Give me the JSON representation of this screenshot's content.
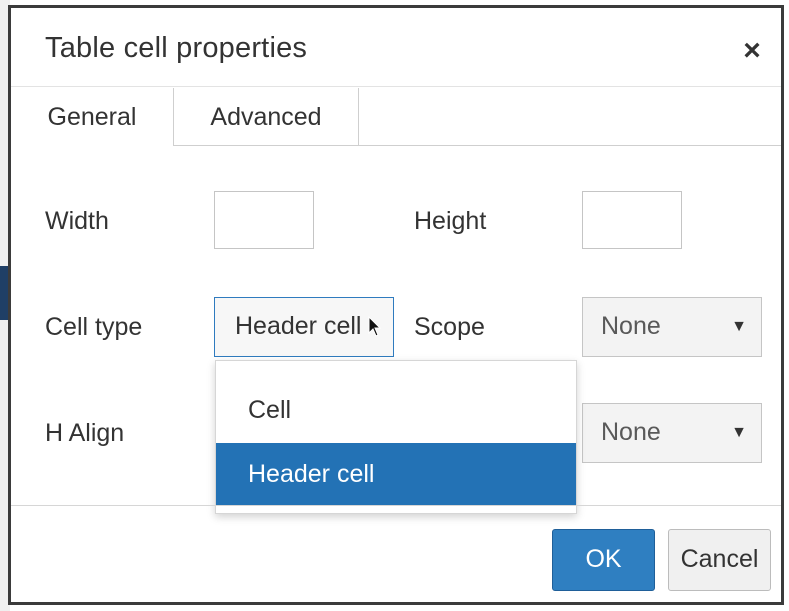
{
  "dialog": {
    "title": "Table cell properties",
    "close_icon": "×"
  },
  "tabs": [
    {
      "label": "General",
      "active": true
    },
    {
      "label": "Advanced",
      "active": false
    }
  ],
  "form": {
    "width": {
      "label": "Width",
      "value": ""
    },
    "height": {
      "label": "Height",
      "value": ""
    },
    "cell_type": {
      "label": "Cell type",
      "value": "Header cell",
      "options": [
        "Cell",
        "Header cell"
      ],
      "selected": "Header cell"
    },
    "scope": {
      "label": "Scope",
      "value": "None"
    },
    "h_align": {
      "label": "H Align",
      "value": "None"
    }
  },
  "footer": {
    "ok_label": "OK",
    "cancel_label": "Cancel"
  },
  "colors": {
    "accent": "#2372b5",
    "ok_button": "#2f7fc1",
    "focus_border": "#2f7bbf"
  }
}
